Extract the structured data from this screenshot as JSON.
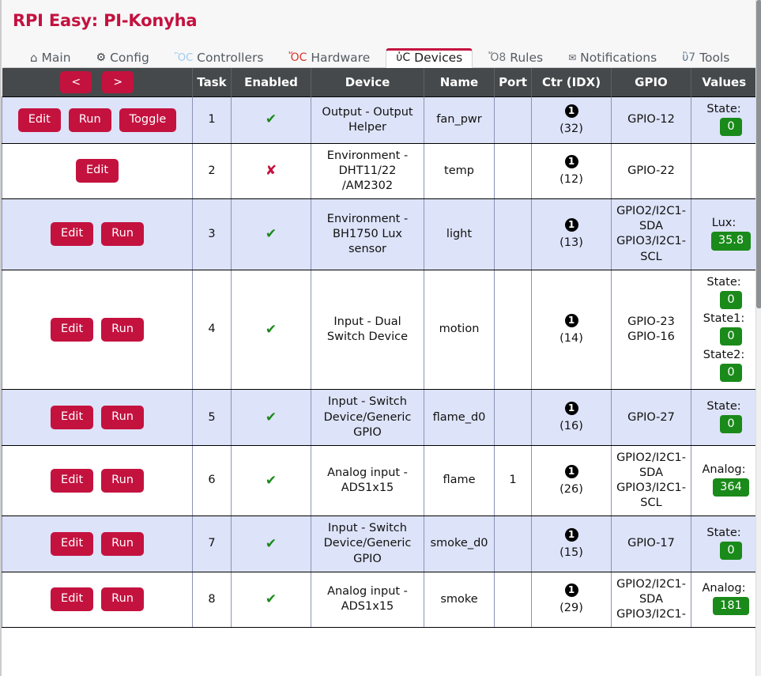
{
  "header": {
    "title": "RPI Easy: PI-Konyha"
  },
  "tabs": [
    {
      "label": "Main",
      "icon": "home-icon",
      "glyph": "⌂",
      "cls": "ico-home",
      "active": false
    },
    {
      "label": "Config",
      "icon": "gear-icon",
      "glyph": "⚙",
      "cls": "ico-gear",
      "active": false
    },
    {
      "label": "Controllers",
      "icon": "chat-icon",
      "glyph": "ὊC",
      "cls": "ico-chat",
      "active": false
    },
    {
      "label": "Hardware",
      "icon": "pin-icon",
      "glyph": "ὌC",
      "cls": "ico-pin",
      "active": false
    },
    {
      "label": "Devices",
      "icon": "plug-icon",
      "glyph": "ὐC",
      "cls": "ico-plug",
      "active": true
    },
    {
      "label": "Rules",
      "icon": "rules-icon",
      "glyph": "Ὄ8",
      "cls": "ico-rules",
      "active": false
    },
    {
      "label": "Notifications",
      "icon": "mail-icon",
      "glyph": "✉",
      "cls": "ico-mail",
      "active": false
    },
    {
      "label": "Tools",
      "icon": "wrench-icon",
      "glyph": "ὒ7",
      "cls": "ico-wrench",
      "active": false
    }
  ],
  "pager": {
    "prev_label": "<",
    "next_label": ">"
  },
  "columns": [
    {
      "key": "actions",
      "label": ""
    },
    {
      "key": "task",
      "label": "Task"
    },
    {
      "key": "enabled",
      "label": "Enabled"
    },
    {
      "key": "device",
      "label": "Device"
    },
    {
      "key": "name",
      "label": "Name"
    },
    {
      "key": "port",
      "label": "Port"
    },
    {
      "key": "ctr",
      "label": "Ctr (IDX)"
    },
    {
      "key": "gpio",
      "label": "GPIO"
    },
    {
      "key": "values",
      "label": "Values"
    }
  ],
  "button_labels": {
    "edit": "Edit",
    "run": "Run",
    "toggle": "Toggle"
  },
  "enabled_glyphs": {
    "yes": "✔",
    "no": "✘"
  },
  "rows": [
    {
      "buttons": [
        "Edit",
        "Run",
        "Toggle"
      ],
      "task": "1",
      "enabled": true,
      "device": "Output - Output Helper",
      "name": "fan_pwr",
      "port": "",
      "ctr_badge": "1",
      "ctr_idx": "(32)",
      "gpio": [
        "GPIO-12"
      ],
      "values": [
        {
          "label": "State:",
          "value": "0"
        }
      ]
    },
    {
      "buttons": [
        "Edit"
      ],
      "task": "2",
      "enabled": false,
      "device": "Environment - DHT11/22 /AM2302",
      "name": "temp",
      "port": "",
      "ctr_badge": "1",
      "ctr_idx": "(12)",
      "gpio": [
        "GPIO-22"
      ],
      "values": []
    },
    {
      "buttons": [
        "Edit",
        "Run"
      ],
      "task": "3",
      "enabled": true,
      "device": "Environment - BH1750 Lux sensor",
      "name": "light",
      "port": "",
      "ctr_badge": "1",
      "ctr_idx": "(13)",
      "gpio": [
        "GPIO2/I2C1-SDA",
        "GPIO3/I2C1-SCL"
      ],
      "values": [
        {
          "label": "Lux:",
          "value": "35.8"
        }
      ]
    },
    {
      "buttons": [
        "Edit",
        "Run"
      ],
      "task": "4",
      "enabled": true,
      "device": "Input - Dual Switch Device",
      "name": "motion",
      "port": "",
      "ctr_badge": "1",
      "ctr_idx": "(14)",
      "gpio": [
        "GPIO-23",
        "GPIO-16"
      ],
      "values": [
        {
          "label": "State:",
          "value": "0"
        },
        {
          "label": "State1:",
          "value": "0"
        },
        {
          "label": "State2:",
          "value": "0"
        }
      ]
    },
    {
      "buttons": [
        "Edit",
        "Run"
      ],
      "task": "5",
      "enabled": true,
      "device": "Input - Switch Device/Generic GPIO",
      "name": "flame_d0",
      "port": "",
      "ctr_badge": "1",
      "ctr_idx": "(16)",
      "gpio": [
        "GPIO-27"
      ],
      "values": [
        {
          "label": "State:",
          "value": "0"
        }
      ]
    },
    {
      "buttons": [
        "Edit",
        "Run"
      ],
      "task": "6",
      "enabled": true,
      "device": "Analog input - ADS1x15",
      "name": "flame",
      "port": "1",
      "ctr_badge": "1",
      "ctr_idx": "(26)",
      "gpio": [
        "GPIO2/I2C1-SDA",
        "GPIO3/I2C1-SCL"
      ],
      "values": [
        {
          "label": "Analog:",
          "value": "364"
        }
      ]
    },
    {
      "buttons": [
        "Edit",
        "Run"
      ],
      "task": "7",
      "enabled": true,
      "device": "Input - Switch Device/Generic GPIO",
      "name": "smoke_d0",
      "port": "",
      "ctr_badge": "1",
      "ctr_idx": "(15)",
      "gpio": [
        "GPIO-17"
      ],
      "values": [
        {
          "label": "State:",
          "value": "0"
        }
      ]
    },
    {
      "buttons": [
        "Edit",
        "Run"
      ],
      "task": "8",
      "enabled": true,
      "device": "Analog input - ADS1x15",
      "name": "smoke",
      "port": "",
      "ctr_badge": "1",
      "ctr_idx": "(29)",
      "gpio": [
        "GPIO2/I2C1-SDA",
        "GPIO3/I2C1-"
      ],
      "values": [
        {
          "label": "Analog:",
          "value": "181"
        }
      ]
    }
  ]
}
